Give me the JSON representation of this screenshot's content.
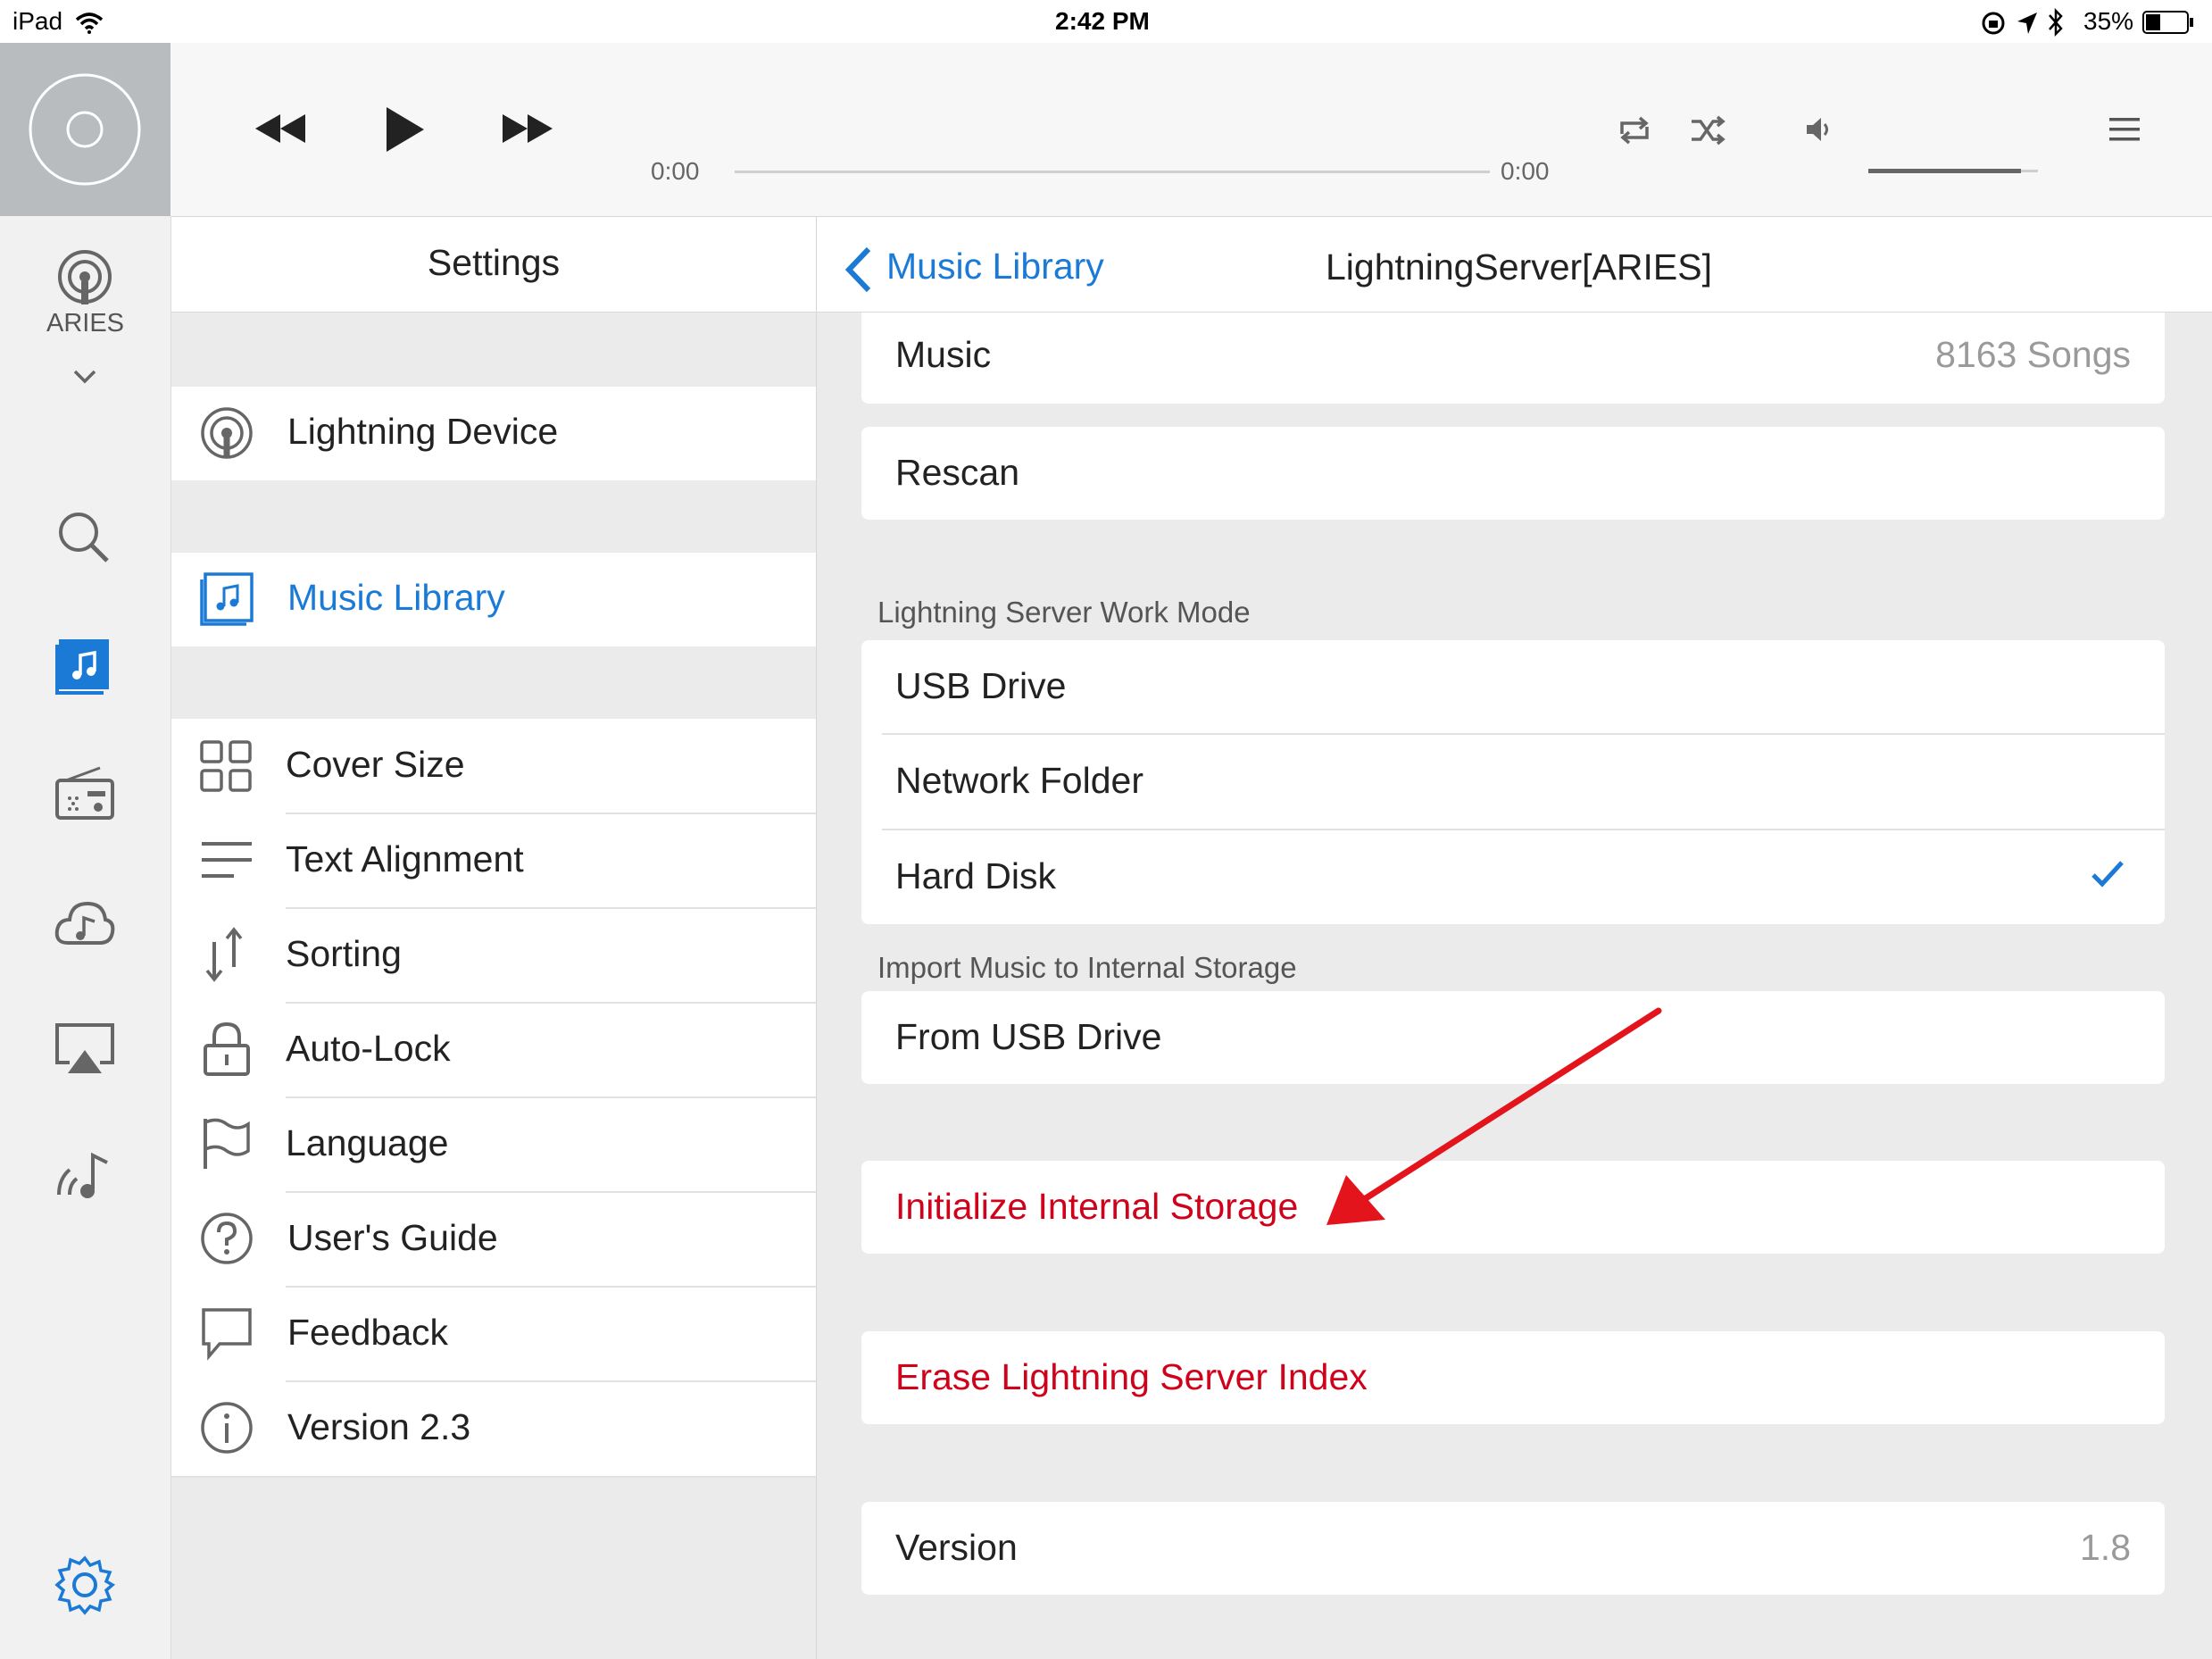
{
  "status_bar": {
    "device": "iPad",
    "time": "2:42 PM",
    "battery": "35%"
  },
  "rail": {
    "device_name": "ARIES",
    "icons": [
      "device-icon",
      "search-icon",
      "music-library-icon",
      "radio-icon",
      "cloud-music-icon",
      "airplay-icon",
      "streaming-icon",
      "settings-icon"
    ]
  },
  "player": {
    "elapsed": "0:00",
    "total": "0:00",
    "volume_level": 0.9
  },
  "settings": {
    "title": "Settings",
    "items": [
      {
        "label": "Lightning Device",
        "icon": "lightning-device-icon"
      },
      {
        "label": "Music Library",
        "icon": "music-library-icon",
        "selected": true
      },
      {
        "label": "Cover Size",
        "icon": "grid-icon"
      },
      {
        "label": "Text Alignment",
        "icon": "align-icon"
      },
      {
        "label": "Sorting",
        "icon": "sort-icon"
      },
      {
        "label": "Auto-Lock",
        "icon": "lock-icon"
      },
      {
        "label": "Language",
        "icon": "flag-icon"
      },
      {
        "label": "User's Guide",
        "icon": "question-icon"
      },
      {
        "label": "Feedback",
        "icon": "speech-bubble-icon"
      },
      {
        "label": "Version 2.3",
        "icon": "info-icon"
      }
    ]
  },
  "detail": {
    "back_label": "Music Library",
    "title": "LightningServer[ARIES]",
    "music_label": "Music",
    "music_count": "8163 Songs",
    "rescan_label": "Rescan",
    "work_mode_header": "Lightning Server Work Mode",
    "work_modes": [
      "USB Drive",
      "Network Folder",
      "Hard Disk"
    ],
    "selected_mode": "Hard Disk",
    "import_header": "Import Music to Internal Storage",
    "import_usb": "From USB Drive",
    "initialize": "Initialize Internal Storage",
    "erase": "Erase Lightning Server Index",
    "version_label": "Version",
    "version_value": "1.8"
  },
  "colors": {
    "accent_blue": "#1a7ad6",
    "destructive_red": "#d0021b",
    "annotation_arrow": "#e3141c"
  }
}
